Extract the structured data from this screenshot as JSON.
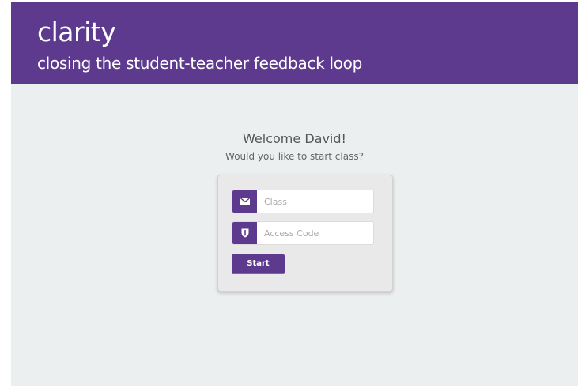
{
  "header": {
    "brand": "clarity",
    "tagline": "closing the student-teacher feedback loop"
  },
  "welcome": {
    "heading": "Welcome David!",
    "subtitle": "Would you like to start class?"
  },
  "form": {
    "class_field": {
      "placeholder": "Class",
      "value": "",
      "icon": "envelope-icon"
    },
    "access_code_field": {
      "placeholder": "Access Code",
      "value": "",
      "icon": "shield-icon"
    },
    "start_label": "Start"
  },
  "colors": {
    "brand_purple": "#5e3a8f",
    "background": "#eceff0",
    "card": "#e9e9e9",
    "button_underline": "#4a74c6"
  }
}
